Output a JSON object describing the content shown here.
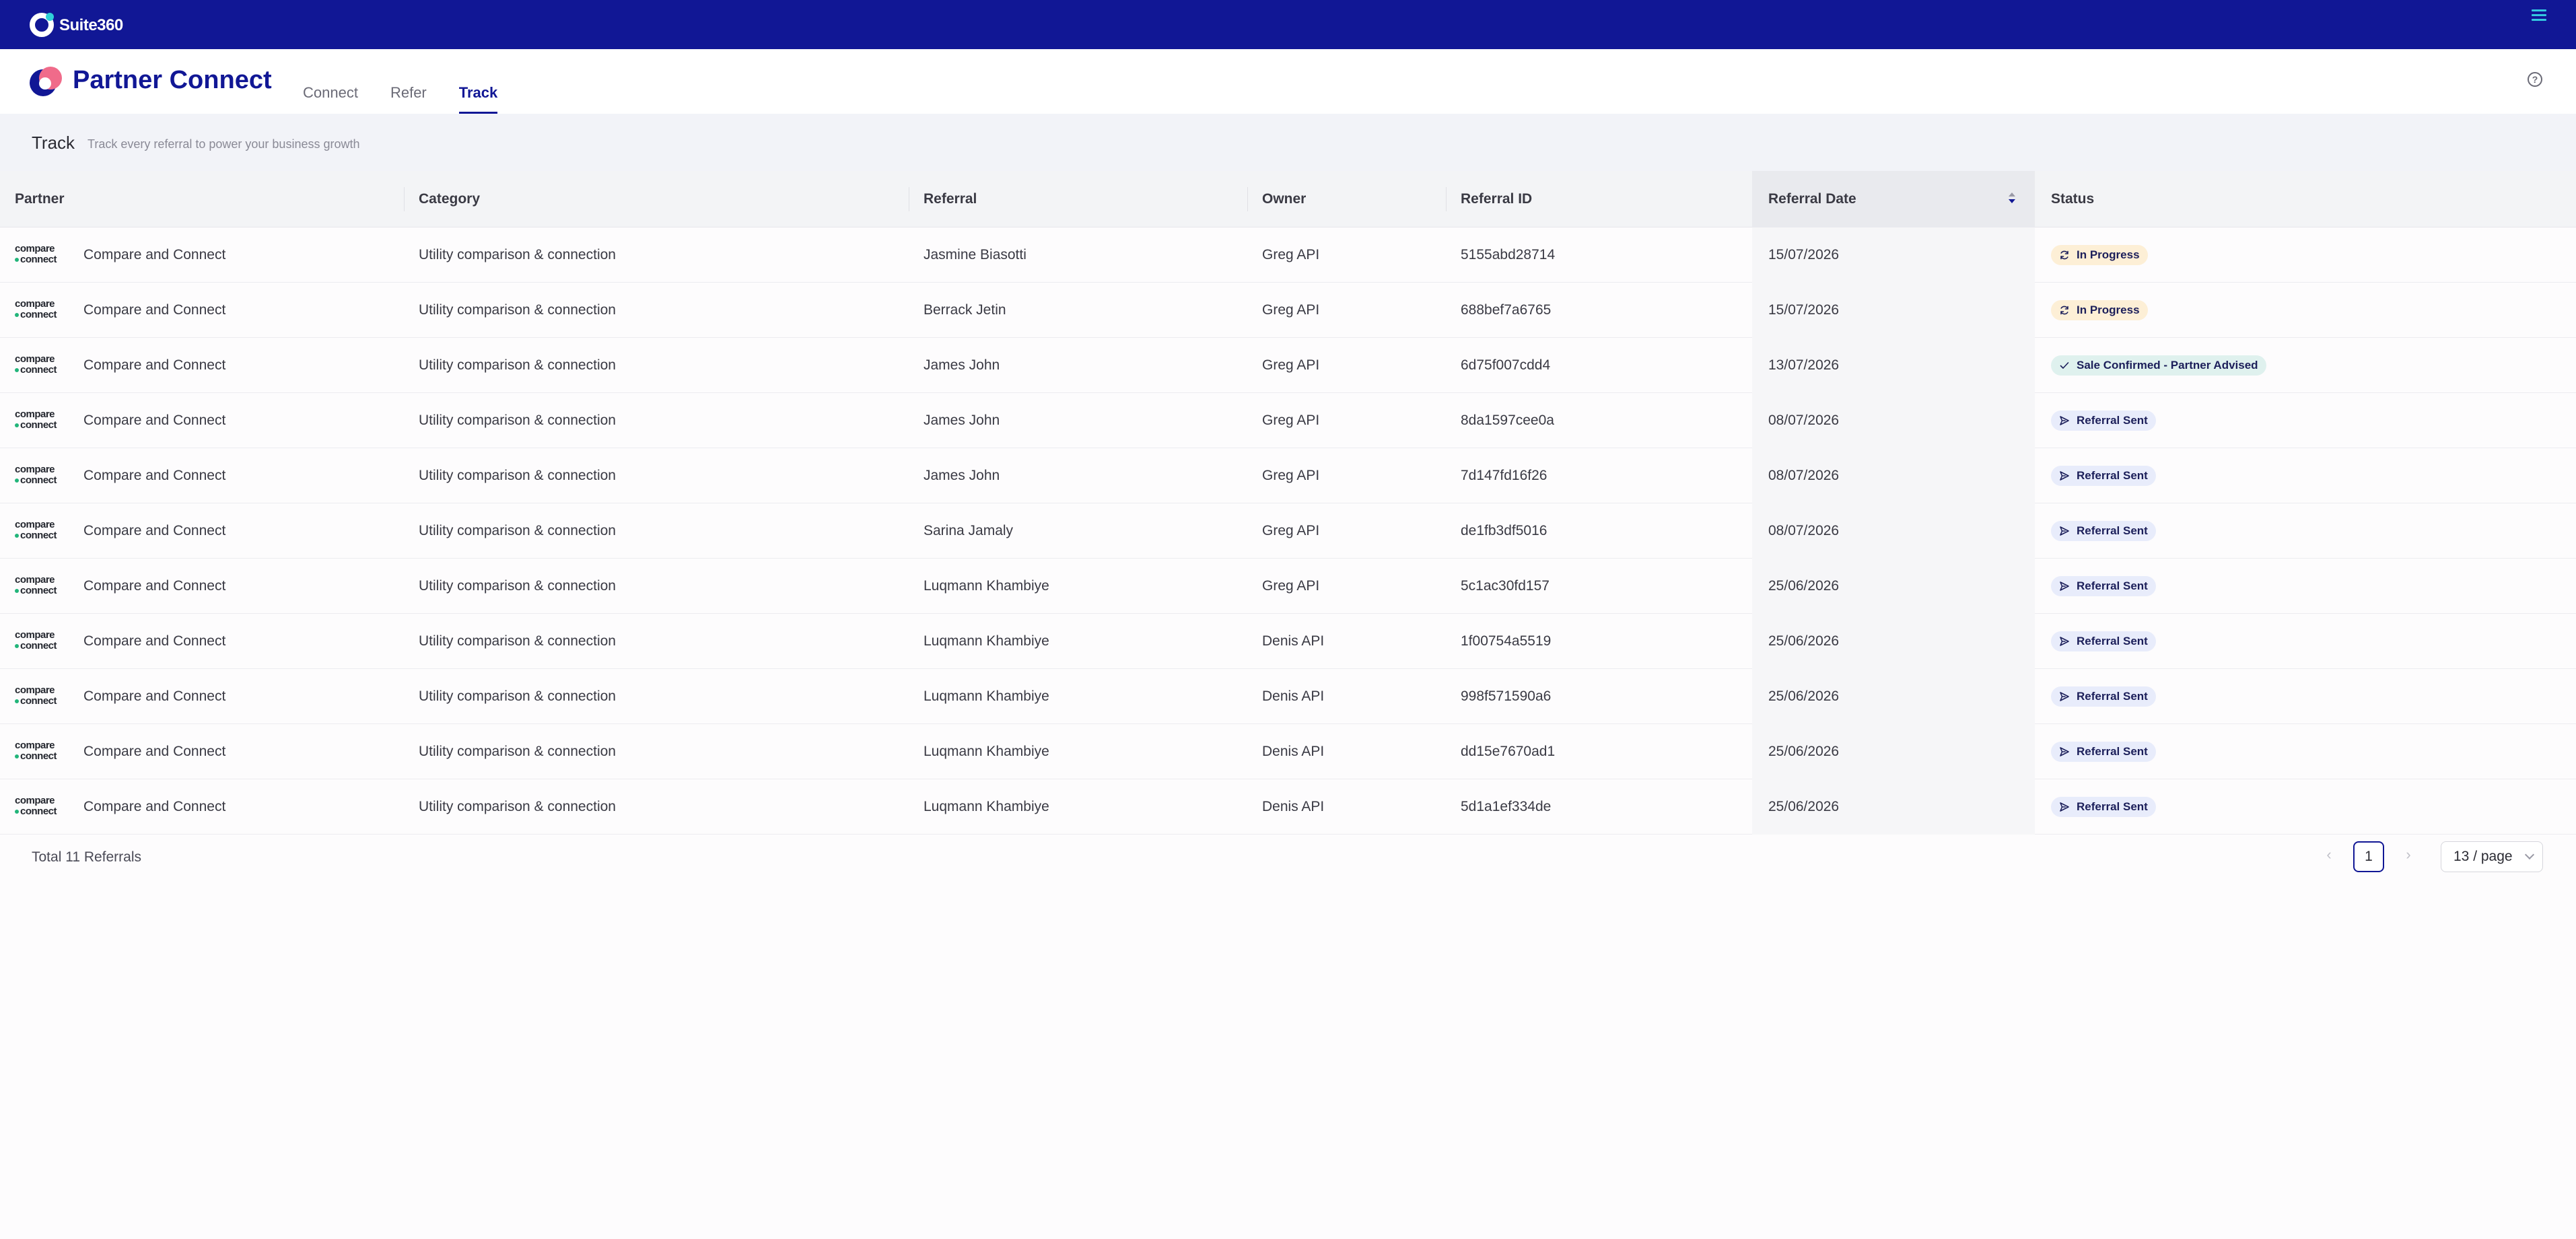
{
  "app": {
    "brand": "Suite360"
  },
  "header": {
    "title": "Partner Connect",
    "tabs": [
      {
        "label": "Connect"
      },
      {
        "label": "Refer"
      },
      {
        "label": "Track"
      }
    ],
    "help_icon": "?"
  },
  "subheader": {
    "title": "Track",
    "description": "Track every referral to power your business growth"
  },
  "table": {
    "columns": [
      "Partner",
      "Category",
      "Referral",
      "Owner",
      "Referral ID",
      "Referral Date",
      "Status"
    ],
    "partner_logo": {
      "line1": "compare",
      "line2": "connect"
    },
    "rows": [
      {
        "partner": "Compare and Connect",
        "category": "Utility comparison & connection",
        "referral": "Jasmine Biasotti",
        "owner": "Greg API",
        "referral_id": "5155abd28714",
        "date": "15/07/2026",
        "status": "In Progress"
      },
      {
        "partner": "Compare and Connect",
        "category": "Utility comparison & connection",
        "referral": "Berrack Jetin",
        "owner": "Greg API",
        "referral_id": "688bef7a6765",
        "date": "15/07/2026",
        "status": "In Progress"
      },
      {
        "partner": "Compare and Connect",
        "category": "Utility comparison & connection",
        "referral": "James John",
        "owner": "Greg API",
        "referral_id": "6d75f007cdd4",
        "date": "13/07/2026",
        "status": "Sale Confirmed - Partner Advised"
      },
      {
        "partner": "Compare and Connect",
        "category": "Utility comparison & connection",
        "referral": "James John",
        "owner": "Greg API",
        "referral_id": "8da1597cee0a",
        "date": "08/07/2026",
        "status": "Referral Sent"
      },
      {
        "partner": "Compare and Connect",
        "category": "Utility comparison & connection",
        "referral": "James John",
        "owner": "Greg API",
        "referral_id": "7d147fd16f26",
        "date": "08/07/2026",
        "status": "Referral Sent"
      },
      {
        "partner": "Compare and Connect",
        "category": "Utility comparison & connection",
        "referral": "Sarina Jamaly",
        "owner": "Greg API",
        "referral_id": "de1fb3df5016",
        "date": "08/07/2026",
        "status": "Referral Sent"
      },
      {
        "partner": "Compare and Connect",
        "category": "Utility comparison & connection",
        "referral": "Luqmann Khambiye",
        "owner": "Greg API",
        "referral_id": "5c1ac30fd157",
        "date": "25/06/2026",
        "status": "Referral Sent"
      },
      {
        "partner": "Compare and Connect",
        "category": "Utility comparison & connection",
        "referral": "Luqmann Khambiye",
        "owner": "Denis API",
        "referral_id": "1f00754a5519",
        "date": "25/06/2026",
        "status": "Referral Sent"
      },
      {
        "partner": "Compare and Connect",
        "category": "Utility comparison & connection",
        "referral": "Luqmann Khambiye",
        "owner": "Denis API",
        "referral_id": "998f571590a6",
        "date": "25/06/2026",
        "status": "Referral Sent"
      },
      {
        "partner": "Compare and Connect",
        "category": "Utility comparison & connection",
        "referral": "Luqmann Khambiye",
        "owner": "Denis API",
        "referral_id": "dd15e7670ad1",
        "date": "25/06/2026",
        "status": "Referral Sent"
      },
      {
        "partner": "Compare and Connect",
        "category": "Utility comparison & connection",
        "referral": "Luqmann Khambiye",
        "owner": "Denis API",
        "referral_id": "5d1a1ef334de",
        "date": "25/06/2026",
        "status": "Referral Sent"
      }
    ]
  },
  "footer": {
    "total": "Total 11 Referrals",
    "current_page": "1",
    "page_size": "13 / page"
  },
  "colors": {
    "appbar": "#111795",
    "accent": "#111795",
    "in_progress_bg": "#fdefd6",
    "confirmed_bg": "#dff1ee",
    "sent_bg": "#e8ecfb"
  },
  "icons": {
    "menu": "hamburger-icon",
    "help": "help-circle-icon",
    "sort": "sort-icon",
    "in_progress": "sync-icon",
    "confirmed": "check-icon",
    "sent": "send-icon",
    "prev": "chevron-left-icon",
    "next": "chevron-right-icon"
  }
}
